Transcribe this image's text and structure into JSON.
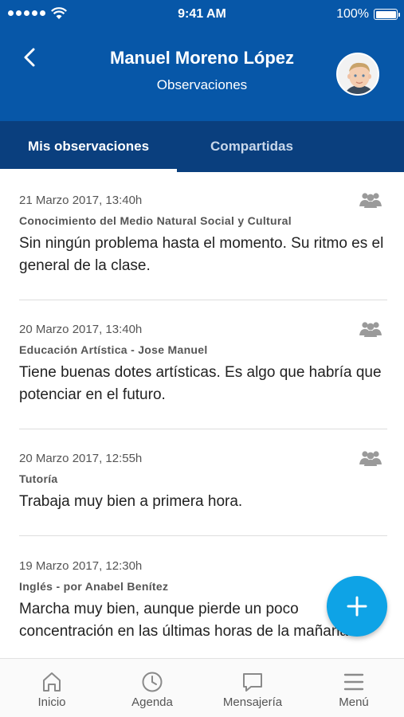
{
  "status_bar": {
    "time": "9:41 AM",
    "battery": "100%"
  },
  "header": {
    "title": "Manuel Moreno López",
    "subtitle": "Observaciones"
  },
  "tabs": [
    {
      "label": "Mis observaciones",
      "active": true
    },
    {
      "label": "Compartidas",
      "active": false
    }
  ],
  "observations": [
    {
      "date": "21 Marzo 2017,  13:40h",
      "subject": "Conocimiento del Medio Natural Social y Cultural",
      "text": "Sin ningún problema hasta el momento. Su ritmo es el general de la clase.",
      "icon": "group-icon"
    },
    {
      "date": "20 Marzo 2017,  13:40h",
      "subject": "Educación Artística - Jose Manuel",
      "text": "Tiene buenas dotes artísticas. Es algo que habría que potenciar en el futuro.",
      "icon": "group-icon"
    },
    {
      "date": "20 Marzo 2017,  12:55h",
      "subject": "Tutoría",
      "text": "Trabaja muy bien a primera hora.",
      "icon": "group-icon"
    },
    {
      "date": "19 Marzo 2017,  12:30h",
      "subject": "Inglés - por Anabel Benítez",
      "text": "Marcha muy bien, aunque pierde un poco concentración en las últimas horas de la mañana."
    }
  ],
  "bottom_nav": [
    {
      "label": "Inicio",
      "icon": "home-icon"
    },
    {
      "label": "Agenda",
      "icon": "clock-icon"
    },
    {
      "label": "Mensajería",
      "icon": "chat-icon"
    },
    {
      "label": "Menú",
      "icon": "menu-icon"
    }
  ],
  "colors": {
    "header": "#0757a8",
    "tabs": "#0a3f7e",
    "fab": "#0ea3e6"
  }
}
